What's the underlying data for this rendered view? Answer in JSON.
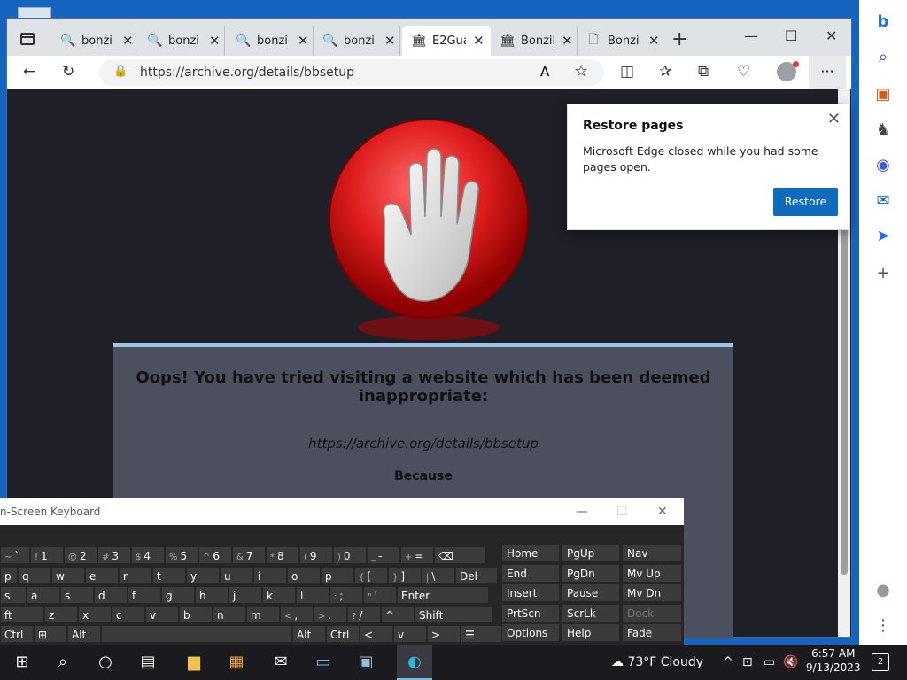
{
  "browser": {
    "tabs": [
      {
        "label": "bonzi",
        "icon": "search-icon"
      },
      {
        "label": "bonzi",
        "icon": "search-icon"
      },
      {
        "label": "bonzi",
        "icon": "search-icon"
      },
      {
        "label": "bonzi",
        "icon": "search-icon"
      },
      {
        "label": "E2Gua",
        "icon": "archive-icon"
      },
      {
        "label": "BonziB",
        "icon": "archive-icon"
      },
      {
        "label": "Bonzi",
        "icon": "document-icon"
      }
    ],
    "url": "https://archive.org/details/bbsetup"
  },
  "page": {
    "heading": "Oops! You have tried visiting a website which has been deemed inappropriate:",
    "blocked_url": "https://archive.org/details/bbsetup",
    "because": "Because"
  },
  "popup": {
    "title": "Restore pages",
    "message": "Microsoft Edge closed while you had some pages open.",
    "button": "Restore"
  },
  "osk": {
    "title": "n-Screen Keyboard",
    "rows": [
      [
        {
          "s": "~",
          "m": "`"
        },
        {
          "s": "!",
          "m": "1"
        },
        {
          "s": "@",
          "m": "2"
        },
        {
          "s": "#",
          "m": "3"
        },
        {
          "s": "$",
          "m": "4"
        },
        {
          "s": "%",
          "m": "5"
        },
        {
          "s": "^",
          "m": "6"
        },
        {
          "s": "&",
          "m": "7"
        },
        {
          "s": "*",
          "m": "8"
        },
        {
          "s": "(",
          "m": "9"
        },
        {
          "s": ")",
          "m": "0"
        },
        {
          "s": "_",
          "m": "-"
        },
        {
          "s": "+",
          "m": "="
        },
        {
          "s": "",
          "m": "⌫"
        }
      ],
      [
        {
          "s": "",
          "m": "p"
        },
        {
          "s": "",
          "m": "q"
        },
        {
          "s": "",
          "m": "w"
        },
        {
          "s": "",
          "m": "e"
        },
        {
          "s": "",
          "m": "r"
        },
        {
          "s": "",
          "m": "t"
        },
        {
          "s": "",
          "m": "y"
        },
        {
          "s": "",
          "m": "u"
        },
        {
          "s": "",
          "m": "i"
        },
        {
          "s": "",
          "m": "o"
        },
        {
          "s": "",
          "m": "p"
        },
        {
          "s": "{",
          "m": "["
        },
        {
          "s": "}",
          "m": "]"
        },
        {
          "s": "|",
          "m": "\\"
        },
        {
          "s": "",
          "m": "Del"
        }
      ],
      [
        {
          "s": "",
          "m": "s"
        },
        {
          "s": "",
          "m": "a"
        },
        {
          "s": "",
          "m": "s"
        },
        {
          "s": "",
          "m": "d"
        },
        {
          "s": "",
          "m": "f"
        },
        {
          "s": "",
          "m": "g"
        },
        {
          "s": "",
          "m": "h"
        },
        {
          "s": "",
          "m": "j"
        },
        {
          "s": "",
          "m": "k"
        },
        {
          "s": "",
          "m": "l"
        },
        {
          "s": ":",
          "m": ";"
        },
        {
          "s": "\"",
          "m": "'"
        },
        {
          "s": "",
          "m": "Enter"
        }
      ],
      [
        {
          "s": "",
          "m": "ft"
        },
        {
          "s": "",
          "m": "z"
        },
        {
          "s": "",
          "m": "x"
        },
        {
          "s": "",
          "m": "c"
        },
        {
          "s": "",
          "m": "v"
        },
        {
          "s": "",
          "m": "b"
        },
        {
          "s": "",
          "m": "n"
        },
        {
          "s": "",
          "m": "m"
        },
        {
          "s": "<",
          "m": ","
        },
        {
          "s": ">",
          "m": "."
        },
        {
          "s": "?",
          "m": "/"
        },
        {
          "s": "",
          "m": "^"
        },
        {
          "s": "",
          "m": "Shift"
        }
      ],
      [
        {
          "s": "",
          "m": "Ctrl"
        },
        {
          "s": "",
          "m": "⊞"
        },
        {
          "s": "",
          "m": "Alt"
        },
        {
          "s": "",
          "m": ""
        },
        {
          "s": "",
          "m": "Alt"
        },
        {
          "s": "",
          "m": "Ctrl"
        },
        {
          "s": "",
          "m": "<"
        },
        {
          "s": "",
          "m": "v"
        },
        {
          "s": "",
          "m": ">"
        },
        {
          "s": "",
          "m": "☰"
        }
      ]
    ],
    "nav_keys": [
      [
        "Home",
        "PgUp",
        "Nav"
      ],
      [
        "End",
        "PgDn",
        "Mv Up"
      ],
      [
        "Insert",
        "Pause",
        "Mv Dn"
      ],
      [
        "PrtScn",
        "ScrLk",
        "Dock"
      ],
      [
        "Options",
        "Help",
        "Fade"
      ]
    ]
  },
  "taskbar": {
    "weather": "73°F  Cloudy",
    "time": "6:57 AM",
    "date": "9/13/2023",
    "notifications": "2"
  },
  "colors": {
    "accent": "#0f6cbd",
    "desktop": "#1565c0"
  }
}
